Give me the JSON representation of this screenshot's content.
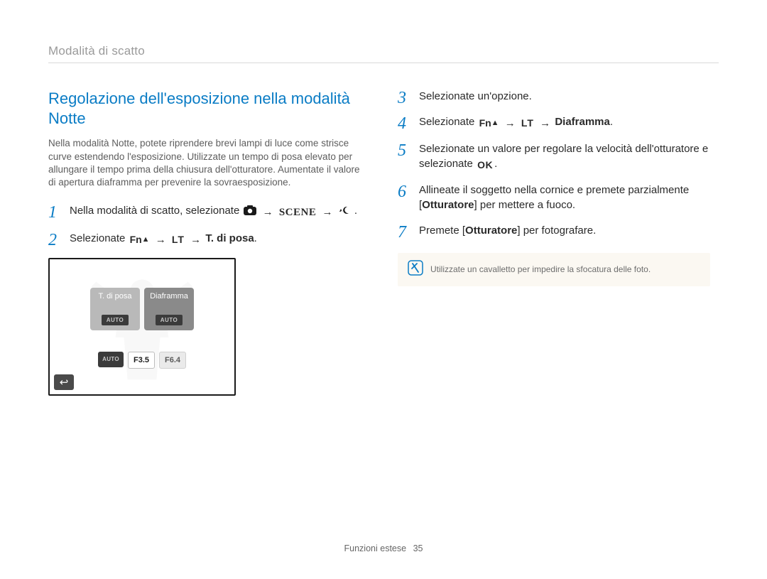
{
  "breadcrumb": "Modalità di scatto",
  "title": "Regolazione dell'esposizione nella modalità Notte",
  "intro": "Nella modalità Notte, potete riprendere brevi lampi di luce come strisce curve estendendo l'esposizione. Utilizzate un tempo di posa elevato per allungare il tempo prima della chiusura dell'otturatore. Aumentate il valore di apertura diaframma per prevenire la sovraesposizione.",
  "steps_left": {
    "s1_pre": "Nella modalità di scatto, selezionate ",
    "s1_post": ".",
    "s2_pre": "Selezionate ",
    "s2_bold": "T. di posa",
    "s2_post": "."
  },
  "steps_right": {
    "s3": "Selezionate un'opzione.",
    "s4_pre": "Selezionate ",
    "s4_bold": "Diaframma",
    "s4_post": ".",
    "s5_pre": "Selezionate un valore per regolare la velocità dell'otturatore e selezionate ",
    "s5_post": ".",
    "s6_pre": "Allineate il soggetto nella cornice e premete parzialmente [",
    "s6_bold": "Otturatore",
    "s6_post": "] per mettere a fuoco.",
    "s7_pre": "Premete [",
    "s7_bold": "Otturatore",
    "s7_post": "] per fotografare."
  },
  "screenshot": {
    "opt1_label": "T. di posa",
    "opt1_val": "AUTO",
    "opt2_label": "Diaframma",
    "opt2_val": "AUTO",
    "ap_auto": "AUTO",
    "ap_sel": "F3.5",
    "ap_dim": "F6.4"
  },
  "note": "Utilizzate un cavalletto per impedire la sfocatura delle foto.",
  "footer_label": "Funzioni estese",
  "footer_page": "35",
  "icon_labels": {
    "arrow": "→",
    "fn": "Fn",
    "lt": "LT",
    "scene": "SCENE",
    "ok": "OK"
  }
}
